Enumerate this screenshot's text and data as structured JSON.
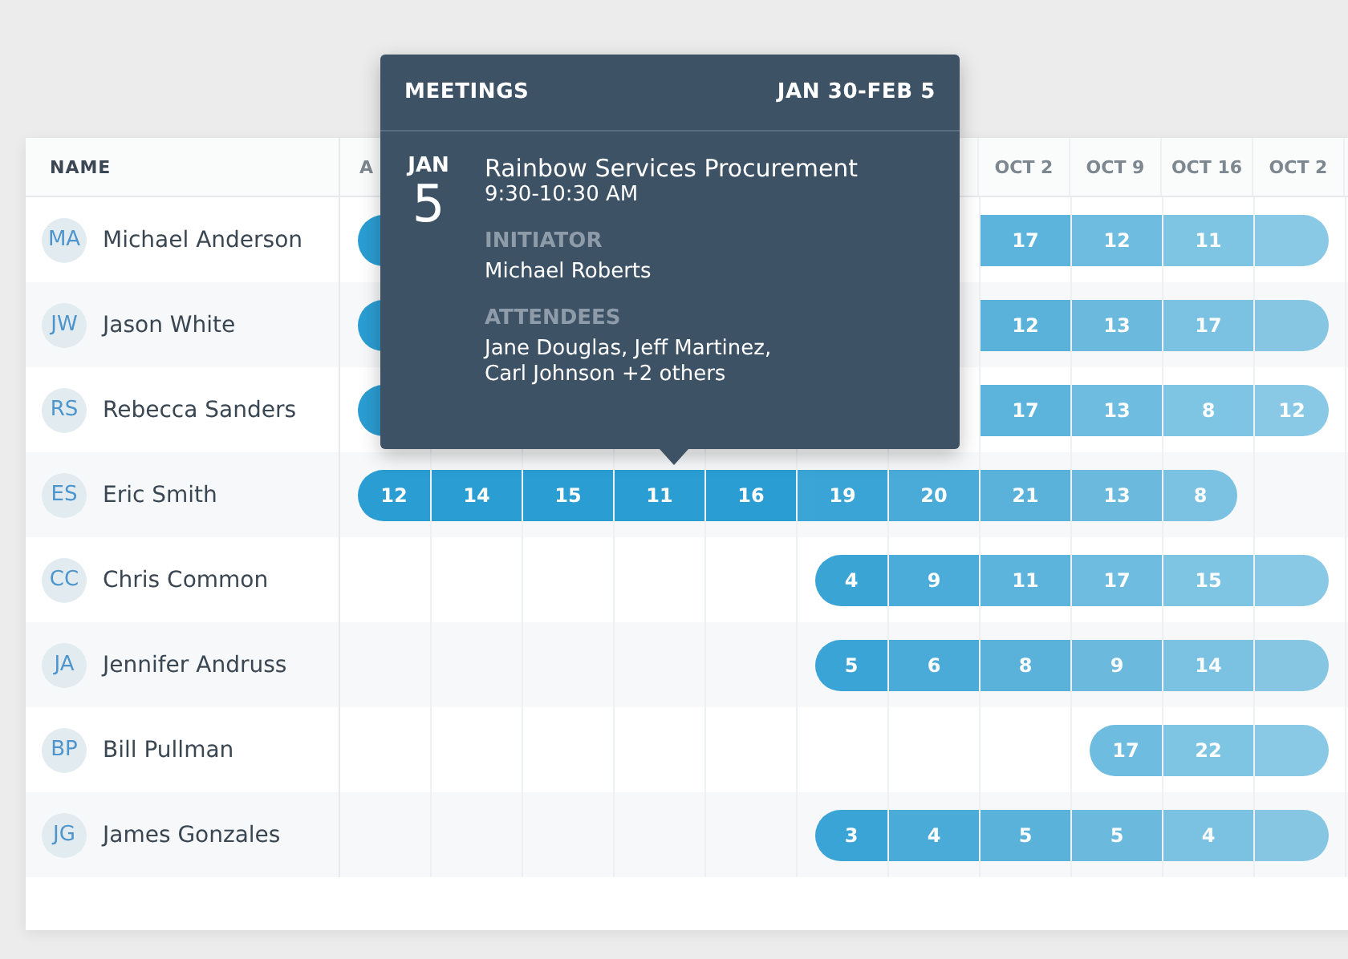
{
  "table": {
    "name_heading": "NAME",
    "columns": [
      "A",
      "",
      "",
      "",
      "",
      "",
      "",
      "OCT 2",
      "OCT 9",
      "OCT 16",
      "OCT 2"
    ],
    "rows": [
      {
        "initials": "MA",
        "name": "Michael Anderson",
        "cells": [
          {
            "bar": true
          },
          null,
          null,
          null,
          null,
          null,
          null,
          {
            "bar": true,
            "value": "17"
          },
          {
            "bar": true,
            "value": "12"
          },
          {
            "bar": true,
            "value": "11"
          },
          {
            "bar": true
          }
        ]
      },
      {
        "initials": "JW",
        "name": "Jason White",
        "cells": [
          {
            "bar": true
          },
          null,
          null,
          null,
          null,
          null,
          null,
          {
            "bar": true,
            "value": "12"
          },
          {
            "bar": true,
            "value": "13"
          },
          {
            "bar": true,
            "value": "17"
          },
          {
            "bar": true
          }
        ]
      },
      {
        "initials": "RS",
        "name": "Rebecca Sanders",
        "cells": [
          {
            "bar": true
          },
          null,
          null,
          null,
          null,
          null,
          null,
          {
            "bar": true,
            "value": "17"
          },
          {
            "bar": true,
            "value": "13"
          },
          {
            "bar": true,
            "value": "8"
          },
          {
            "bar": true,
            "value": "12"
          }
        ]
      },
      {
        "initials": "ES",
        "name": "Eric Smith",
        "cells": [
          {
            "bar": true,
            "value": "12"
          },
          {
            "bar": true,
            "value": "14"
          },
          {
            "bar": true,
            "value": "15"
          },
          {
            "bar": true,
            "value": "11"
          },
          {
            "bar": true,
            "value": "16"
          },
          {
            "bar": true,
            "value": "19"
          },
          {
            "bar": true,
            "value": "20"
          },
          {
            "bar": true,
            "value": "21"
          },
          {
            "bar": true,
            "value": "13"
          },
          {
            "bar": true,
            "value": "8"
          },
          {
            "bar": false
          }
        ]
      },
      {
        "initials": "CC",
        "name": "Chris Common",
        "cells": [
          {
            "bar": false
          },
          {
            "bar": false
          },
          {
            "bar": false
          },
          {
            "bar": false
          },
          {
            "bar": false
          },
          {
            "bar": true,
            "value": "4"
          },
          {
            "bar": true,
            "value": "9"
          },
          {
            "bar": true,
            "value": "11"
          },
          {
            "bar": true,
            "value": "17"
          },
          {
            "bar": true,
            "value": "15"
          },
          {
            "bar": true
          }
        ]
      },
      {
        "initials": "JA",
        "name": "Jennifer Andruss",
        "cells": [
          {
            "bar": false
          },
          {
            "bar": false
          },
          {
            "bar": false
          },
          {
            "bar": false
          },
          {
            "bar": false
          },
          {
            "bar": true,
            "value": "5"
          },
          {
            "bar": true,
            "value": "6"
          },
          {
            "bar": true,
            "value": "8"
          },
          {
            "bar": true,
            "value": "9"
          },
          {
            "bar": true,
            "value": "14"
          },
          {
            "bar": true
          }
        ]
      },
      {
        "initials": "BP",
        "name": "Bill Pullman",
        "cells": [
          {
            "bar": false
          },
          {
            "bar": false
          },
          {
            "bar": false
          },
          {
            "bar": false
          },
          {
            "bar": false
          },
          {
            "bar": false
          },
          {
            "bar": false
          },
          {
            "bar": false
          },
          {
            "bar": true,
            "value": "17"
          },
          {
            "bar": true,
            "value": "22"
          },
          {
            "bar": true
          }
        ]
      },
      {
        "initials": "JG",
        "name": "James Gonzales",
        "cells": [
          {
            "bar": false
          },
          {
            "bar": false
          },
          {
            "bar": false
          },
          {
            "bar": false
          },
          {
            "bar": false
          },
          {
            "bar": true,
            "value": "3"
          },
          {
            "bar": true,
            "value": "4"
          },
          {
            "bar": true,
            "value": "5"
          },
          {
            "bar": true,
            "value": "5"
          },
          {
            "bar": true,
            "value": "4"
          },
          {
            "bar": true
          }
        ]
      }
    ]
  },
  "popup": {
    "title": "MEETINGS",
    "range": "JAN 30-FEB 5",
    "month": "JAN",
    "day": "5",
    "event": "Rainbow Services Procurement",
    "time": "9:30-10:30 AM",
    "initiator_label": "INITIATOR",
    "initiator": "Michael Roberts",
    "attendees_label": "ATTENDEES",
    "attendees": [
      "Jane Douglas, Jeff Martinez,",
      "Carl Johnson +2 others"
    ]
  }
}
